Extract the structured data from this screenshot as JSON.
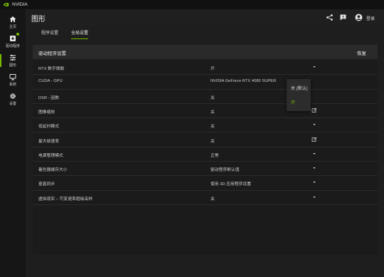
{
  "window": {
    "title": "NVIDIA"
  },
  "sidebar": {
    "items": [
      {
        "label": "主页",
        "icon": "home-icon"
      },
      {
        "label": "驱动程序",
        "icon": "driver-download-icon",
        "badge": true
      },
      {
        "label": "图形",
        "icon": "sliders-icon",
        "active": true
      },
      {
        "label": "系统",
        "icon": "system-monitor-icon"
      },
      {
        "label": "设置",
        "icon": "gear-icon"
      }
    ]
  },
  "header": {
    "title": "图形",
    "share_icon": "share-icon",
    "feedback_icon": "feedback-icon",
    "avatar_icon": "user-avatar-icon",
    "login_label": "登录"
  },
  "tabs": [
    {
      "label": "程序设置",
      "active": false
    },
    {
      "label": "全局设置",
      "active": true
    }
  ],
  "settings": {
    "title": "驱动程序设置",
    "restore_label": "恢复",
    "rows": [
      {
        "name": "RTX 数字振動",
        "value": "开",
        "control": "chevron-down-icon"
      },
      {
        "name": "CUDA - GPU",
        "value": "NVIDIA GeForce RTX 4080 SUPER",
        "control": "chevron-down-icon"
      },
      {
        "name": "DSR - 因数",
        "value": "关",
        "control": "edit-icon"
      },
      {
        "name": "图像缩放",
        "value": "关",
        "control": "edit-icon"
      },
      {
        "name": "低延时模式",
        "value": "关",
        "control": "chevron-down-icon"
      },
      {
        "name": "最大帧速率",
        "value": "关",
        "control": "edit-icon"
      },
      {
        "name": "电源管理模式",
        "value": "正常",
        "control": "chevron-down-icon"
      },
      {
        "name": "着色器缓存大小",
        "value": "驱动程序默认值",
        "control": "chevron-down-icon"
      },
      {
        "name": "垂直同步",
        "value": "使用 3D 应用程序设置",
        "control": "chevron-down-icon"
      },
      {
        "name": "虚拟现实 – 可变速率超级采样",
        "value": "关",
        "control": "chevron-down-icon"
      }
    ]
  },
  "dropdown": {
    "options": [
      {
        "label": "关 (默认)",
        "selected": false
      },
      {
        "label": "开",
        "selected": true
      }
    ]
  },
  "colors": {
    "accent": "#76b900",
    "background": "#1e1e1e",
    "sidebar": "#161616",
    "panel_header": "#2a2a2a"
  }
}
